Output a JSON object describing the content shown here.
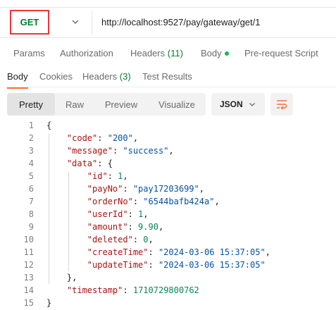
{
  "request": {
    "method": "GET",
    "url": "http://localhost:9527/pay/gateway/get/1"
  },
  "request_tabs": [
    {
      "label": "Params"
    },
    {
      "label": "Authorization"
    },
    {
      "label": "Headers",
      "count": "(11)"
    },
    {
      "label": "Body"
    },
    {
      "label": "Pre-request Script"
    }
  ],
  "response_tabs": [
    {
      "label": "Body"
    },
    {
      "label": "Cookies"
    },
    {
      "label": "Headers",
      "count": "(3)"
    },
    {
      "label": "Test Results"
    }
  ],
  "view_modes": [
    "Pretty",
    "Raw",
    "Preview",
    "Visualize"
  ],
  "format": "JSON",
  "colors": {
    "method": "#007f31",
    "highlight_box": "#e8383d",
    "body_dot": "#0cbb52",
    "active_tab_underline": "#ff6c37",
    "json_key": "#a31515",
    "json_string": "#0451a5",
    "json_number": "#098658",
    "wrap_icon": "#ff6c37"
  },
  "icons": [
    "chevron-down-icon",
    "wrap-lines-icon"
  ],
  "code_lines": [
    {
      "n": "1",
      "t": [
        {
          "v": "{",
          "c": "p"
        }
      ]
    },
    {
      "n": "2",
      "t": [
        {
          "v": "    ",
          "c": "p"
        },
        {
          "v": "\"code\"",
          "c": "k"
        },
        {
          "v": ": ",
          "c": "p"
        },
        {
          "v": "\"200\"",
          "c": "s"
        },
        {
          "v": ",",
          "c": "p"
        }
      ]
    },
    {
      "n": "3",
      "t": [
        {
          "v": "    ",
          "c": "p"
        },
        {
          "v": "\"message\"",
          "c": "k"
        },
        {
          "v": ": ",
          "c": "p"
        },
        {
          "v": "\"success\"",
          "c": "s"
        },
        {
          "v": ",",
          "c": "p"
        }
      ]
    },
    {
      "n": "4",
      "t": [
        {
          "v": "    ",
          "c": "p"
        },
        {
          "v": "\"data\"",
          "c": "k"
        },
        {
          "v": ": {",
          "c": "p"
        }
      ]
    },
    {
      "n": "5",
      "t": [
        {
          "v": "        ",
          "c": "p"
        },
        {
          "v": "\"id\"",
          "c": "k"
        },
        {
          "v": ": ",
          "c": "p"
        },
        {
          "v": "1",
          "c": "n"
        },
        {
          "v": ",",
          "c": "p"
        }
      ]
    },
    {
      "n": "6",
      "t": [
        {
          "v": "        ",
          "c": "p"
        },
        {
          "v": "\"payNo\"",
          "c": "k"
        },
        {
          "v": ": ",
          "c": "p"
        },
        {
          "v": "\"pay17203699\"",
          "c": "s"
        },
        {
          "v": ",",
          "c": "p"
        }
      ]
    },
    {
      "n": "7",
      "t": [
        {
          "v": "        ",
          "c": "p"
        },
        {
          "v": "\"orderNo\"",
          "c": "k"
        },
        {
          "v": ": ",
          "c": "p"
        },
        {
          "v": "\"6544bafb424a\"",
          "c": "s"
        },
        {
          "v": ",",
          "c": "p"
        }
      ]
    },
    {
      "n": "8",
      "t": [
        {
          "v": "        ",
          "c": "p"
        },
        {
          "v": "\"userId\"",
          "c": "k"
        },
        {
          "v": ": ",
          "c": "p"
        },
        {
          "v": "1",
          "c": "n"
        },
        {
          "v": ",",
          "c": "p"
        }
      ]
    },
    {
      "n": "9",
      "t": [
        {
          "v": "        ",
          "c": "p"
        },
        {
          "v": "\"amount\"",
          "c": "k"
        },
        {
          "v": ": ",
          "c": "p"
        },
        {
          "v": "9.90",
          "c": "n"
        },
        {
          "v": ",",
          "c": "p"
        }
      ]
    },
    {
      "n": "10",
      "t": [
        {
          "v": "        ",
          "c": "p"
        },
        {
          "v": "\"deleted\"",
          "c": "k"
        },
        {
          "v": ": ",
          "c": "p"
        },
        {
          "v": "0",
          "c": "n"
        },
        {
          "v": ",",
          "c": "p"
        }
      ]
    },
    {
      "n": "11",
      "t": [
        {
          "v": "        ",
          "c": "p"
        },
        {
          "v": "\"createTime\"",
          "c": "k"
        },
        {
          "v": ": ",
          "c": "p"
        },
        {
          "v": "\"2024-03-06 15:37:05\"",
          "c": "s"
        },
        {
          "v": ",",
          "c": "p"
        }
      ]
    },
    {
      "n": "12",
      "t": [
        {
          "v": "        ",
          "c": "p"
        },
        {
          "v": "\"updateTime\"",
          "c": "k"
        },
        {
          "v": ": ",
          "c": "p"
        },
        {
          "v": "\"2024-03-06 15:37:05\"",
          "c": "s"
        }
      ]
    },
    {
      "n": "13",
      "t": [
        {
          "v": "    },",
          "c": "p"
        }
      ]
    },
    {
      "n": "14",
      "t": [
        {
          "v": "    ",
          "c": "p"
        },
        {
          "v": "\"timestamp\"",
          "c": "k"
        },
        {
          "v": ": ",
          "c": "p"
        },
        {
          "v": "1710729800762",
          "c": "n"
        }
      ]
    },
    {
      "n": "15",
      "t": [
        {
          "v": "}",
          "c": "p"
        }
      ]
    }
  ]
}
